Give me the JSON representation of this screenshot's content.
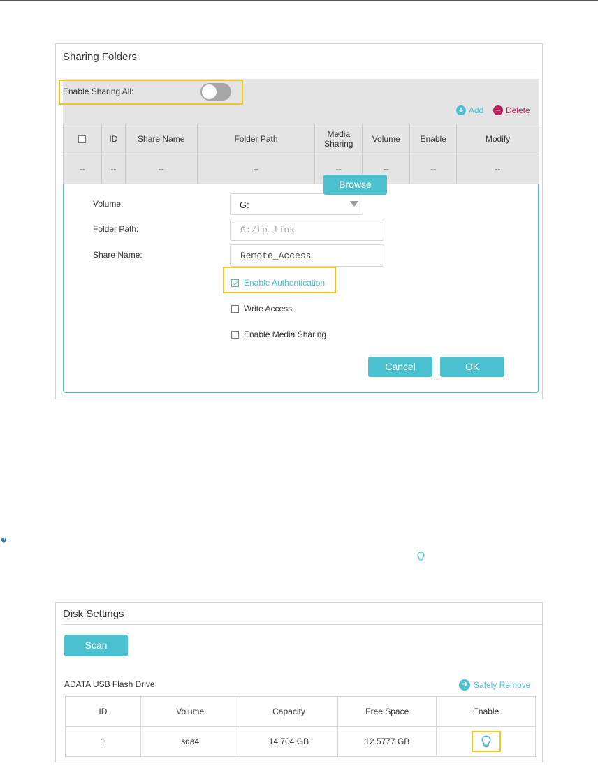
{
  "sharing_panel": {
    "title": "Sharing Folders",
    "enable_sharing_all_label": "Enable Sharing All:",
    "add_label": "Add",
    "delete_label": "Delete",
    "columns": [
      "ID",
      "Share Name",
      "Folder Path",
      "Media Sharing",
      "Volume",
      "Enable",
      "Modify"
    ],
    "row": [
      "--",
      "--",
      "--",
      "--",
      "--",
      "--",
      "--",
      "--"
    ],
    "form": {
      "volume_label": "Volume:",
      "volume_value": "G:",
      "folder_path_label": "Folder Path:",
      "folder_path_placeholder": "G:/tp-link",
      "browse_label": "Browse",
      "share_name_label": "Share Name:",
      "share_name_value": "Remote_Access",
      "enable_auth_label": "Enable Authentication",
      "write_access_label": "Write Access",
      "enable_media_label": "Enable Media Sharing",
      "cancel_label": "Cancel",
      "ok_label": "OK"
    }
  },
  "disk_panel": {
    "title": "Disk Settings",
    "scan_label": "Scan",
    "drive_name": "ADATA  USB Flash Drive",
    "safely_remove_label": "Safely Remove",
    "columns": [
      "ID",
      "Volume",
      "Capacity",
      "Free Space",
      "Enable"
    ],
    "rows": [
      {
        "id": "1",
        "volume": "sda4",
        "capacity": "14.704 GB",
        "free_space": "12.5777 GB"
      }
    ]
  },
  "colors": {
    "accent": "#4bc0cf",
    "delete": "#c2185b",
    "highlight": "#f5c518",
    "toggle_off": "#a6a6a6"
  },
  "icons": [
    "add-icon",
    "delete-icon",
    "dropdown-arrow-icon",
    "checkbox-checked-icon",
    "safely-remove-icon",
    "bulb-icon",
    "tag-icon"
  ],
  "state": {
    "sharing_all_enabled": false,
    "enable_authentication": true,
    "write_access": false,
    "enable_media_sharing": false
  }
}
